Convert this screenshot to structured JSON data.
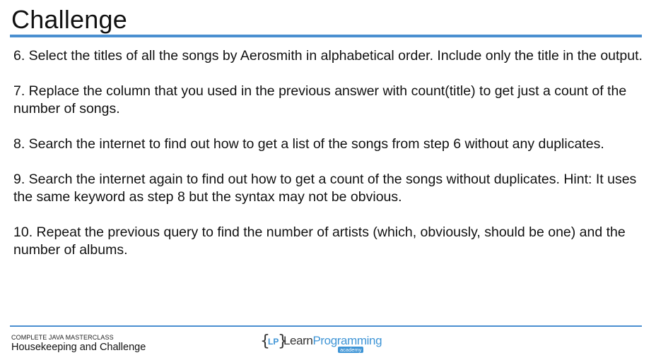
{
  "slide": {
    "title": "Challenge"
  },
  "challenges": [
    "6. Select the titles of all the songs by Aerosmith in alphabetical order. Include only the title in the output.",
    "7. Replace the column that you used in the previous answer with count(title) to get just a count of the  number of songs.",
    "8. Search the internet to find out how to get a list of the songs from step 6 without any duplicates.",
    "9. Search the internet again to find out how to get a count of the songs without duplicates. Hint: It uses the same keyword as step 8 but the syntax may not be obvious.",
    "10. Repeat the previous query to find the number of artists (which, obviously, should be one) and the number of albums."
  ],
  "footer": {
    "course": "COMPLETE JAVA MASTERCLASS",
    "subtitle": "Housekeeping and Challenge"
  },
  "logo": {
    "bracket_open": "{",
    "bracket_close": "}",
    "initials": "LP",
    "word_part1": "Learn",
    "word_part2": "Programming",
    "tag": "academy"
  },
  "colors": {
    "accent": "#4a8fd0",
    "logo_blue": "#3f95d6",
    "text": "#111111"
  }
}
